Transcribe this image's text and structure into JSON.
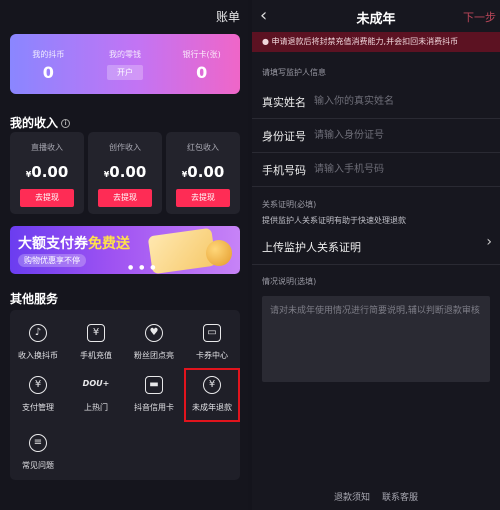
{
  "left": {
    "bill_label": "账单",
    "wallet": [
      {
        "label": "我的抖币",
        "value": "0"
      },
      {
        "label": "我的零钱",
        "button": "开户"
      },
      {
        "label": "银行卡(张)",
        "value": "0"
      }
    ],
    "income_title": "我的收入",
    "income_info_icon": "i",
    "income": [
      {
        "label": "直播收入",
        "currency": "¥",
        "value": "0.00",
        "button": "去提现"
      },
      {
        "label": "创作收入",
        "currency": "¥",
        "value": "0.00",
        "button": "去提现"
      },
      {
        "label": "红包收入",
        "currency": "¥",
        "value": "0.00",
        "button": "去提现"
      }
    ],
    "banner": {
      "line1_a": "大额支付券",
      "line1_b": "免费送",
      "line2": "购物优惠享不停"
    },
    "services_title": "其他服务",
    "services": [
      {
        "label": "收入换抖币",
        "icon": "douyin-icon",
        "glyph": "♪"
      },
      {
        "label": "手机充值",
        "icon": "phone-icon",
        "glyph": "¥"
      },
      {
        "label": "粉丝团点亮",
        "icon": "heart-icon",
        "glyph": "♥"
      },
      {
        "label": "卡券中心",
        "icon": "ticket-icon",
        "glyph": "▭"
      },
      {
        "label": "支付管理",
        "icon": "shield-icon",
        "glyph": "¥"
      },
      {
        "label": "上热门",
        "icon": "dou-plus-icon",
        "glyph": "DOU+"
      },
      {
        "label": "抖音信用卡",
        "icon": "credit-card-icon",
        "glyph": "▬"
      },
      {
        "label": "未成年退款",
        "icon": "minor-refund-icon",
        "glyph": "¥"
      },
      {
        "label": "常见问题",
        "icon": "faq-icon",
        "glyph": "≡"
      }
    ]
  },
  "right": {
    "title": "未成年",
    "next": "下一步",
    "notice": "申请退款后将封禁充值消费能力,并会扣回未消费抖币",
    "guardian_section": "请填写监护人信息",
    "fields": [
      {
        "label": "真实姓名",
        "placeholder": "输入你的真实姓名"
      },
      {
        "label": "身份证号",
        "placeholder": "请输入身份证号"
      },
      {
        "label": "手机号码",
        "placeholder": "请输入手机号码"
      }
    ],
    "relation_section": "关系证明(必填)",
    "relation_hint": "提供监护人关系证明有助于快速处理退款",
    "upload_label": "上传监护人关系证明",
    "situation_section": "情况说明(选填)",
    "situation_placeholder": "请对未成年使用情况进行简要说明,辅以判断退款审核",
    "footer": {
      "refund_notice": "退款须知",
      "contact": "联系客服"
    }
  },
  "colors": {
    "accent": "#fe2c55",
    "highlight_box": "#e1141d",
    "notice_bg": "#5c1222"
  }
}
